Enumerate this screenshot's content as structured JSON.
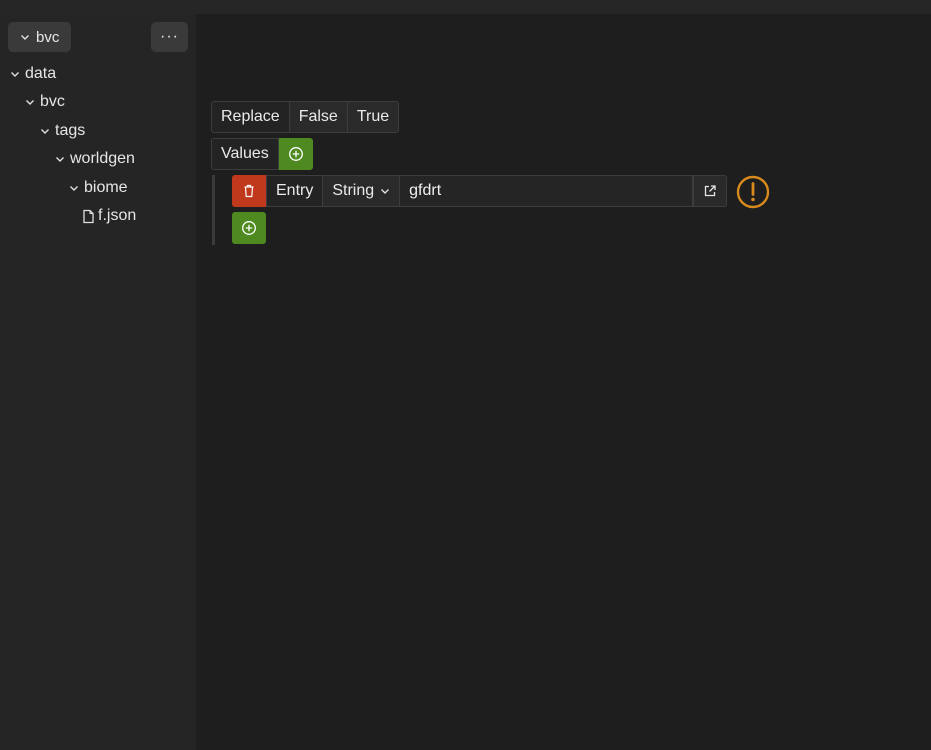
{
  "sidebar": {
    "project_label": "bvc",
    "more_label": "···",
    "tree": [
      {
        "label": "data",
        "type": "folder",
        "depth": 0
      },
      {
        "label": "bvc",
        "type": "folder",
        "depth": 1
      },
      {
        "label": "tags",
        "type": "folder",
        "depth": 2
      },
      {
        "label": "worldgen",
        "type": "folder",
        "depth": 3
      },
      {
        "label": "biome",
        "type": "folder",
        "depth": 4
      },
      {
        "label": "f.json",
        "type": "file",
        "depth": 5
      }
    ]
  },
  "editor": {
    "replace": {
      "label": "Replace",
      "options": [
        "False",
        "True"
      ]
    },
    "values": {
      "label": "Values"
    },
    "entry": {
      "label": "Entry",
      "type_value": "String",
      "value": "gfdrt"
    }
  },
  "icons": {
    "chevron": "chevron-down-icon",
    "file": "file-icon",
    "add": "plus-circle-icon",
    "delete": "trash-icon",
    "link": "external-link-icon",
    "warning": "warning-icon"
  },
  "colors": {
    "green": "#4e8a1f",
    "red": "#c0391d",
    "warning": "#d88a1c"
  }
}
